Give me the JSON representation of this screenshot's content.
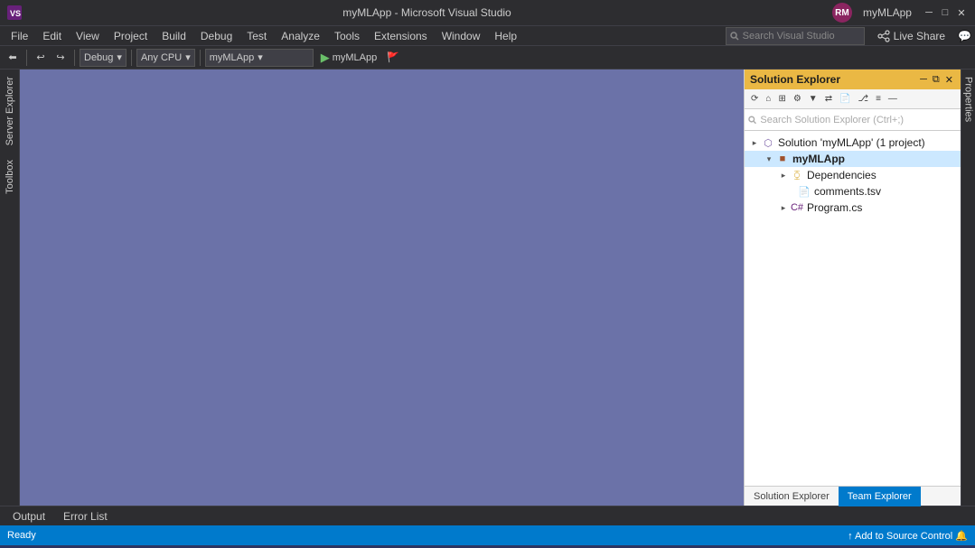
{
  "titleBar": {
    "appName": "myMLApp",
    "windowTitle": "myMLApp - Microsoft Visual Studio",
    "userInitials": "RM",
    "minimize": "─",
    "maximize": "□",
    "close": "✕"
  },
  "menuBar": {
    "items": [
      "File",
      "Edit",
      "View",
      "Project",
      "Build",
      "Debug",
      "Test",
      "Analyze",
      "Tools",
      "Extensions",
      "Window",
      "Help"
    ]
  },
  "toolbar": {
    "debugConfig": "Debug",
    "platform": "Any CPU",
    "startupProject": "myMLApp",
    "startTarget": "myMLApp",
    "searchPlaceholder": "Search Visual Studio",
    "liveShare": "Live Share"
  },
  "solutionExplorer": {
    "title": "Solution Explorer",
    "searchPlaceholder": "Search Solution Explorer (Ctrl+;)",
    "tree": {
      "solution": "Solution 'myMLApp' (1 project)",
      "project": "myMLApp",
      "dependencies": "Dependencies",
      "commentsFile": "comments.tsv",
      "programFile": "Program.cs"
    },
    "bottomTabs": [
      "Solution Explorer",
      "Team Explorer"
    ]
  },
  "leftSidebar": {
    "tabs": [
      "Server Explorer",
      "Toolbox"
    ]
  },
  "rightSidebar": {
    "tabs": [
      "Properties"
    ]
  },
  "bottomTabs": {
    "items": [
      "Output",
      "Error List"
    ]
  },
  "statusBar": {
    "left": "Ready",
    "right": "↑ Add to Source Control  🔔"
  }
}
